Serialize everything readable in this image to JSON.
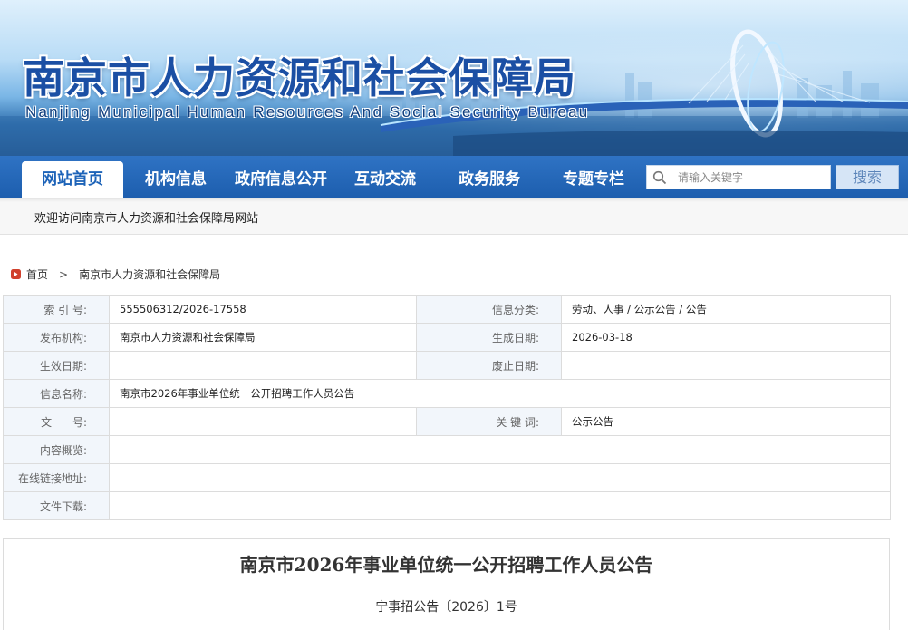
{
  "site": {
    "title_cn": "南京市人力资源和社会保障局",
    "title_en": "Nanjing Municipal Human Resources And Social Security Bureau"
  },
  "nav": {
    "items": [
      {
        "label": "网站首页",
        "active": true
      },
      {
        "label": "机构信息",
        "active": false
      },
      {
        "label": "政府信息公开",
        "active": false
      },
      {
        "label": "互动交流",
        "active": false
      },
      {
        "label": "政务服务",
        "active": false
      },
      {
        "label": "专题专栏",
        "active": false
      }
    ]
  },
  "search": {
    "placeholder": "请输入关键字",
    "button_label": "搜索",
    "icon": "search-icon"
  },
  "welcome": "欢迎访问南京市人力资源和社会保障局网站",
  "breadcrumb": {
    "home": "首页",
    "separator": ">",
    "current": "南京市人力资源和社会保障局",
    "home_icon": "home-icon",
    "home_icon_color": "#d0402c"
  },
  "info": {
    "index_label": "索 引 号:",
    "index_value": "555506312/2026-17558",
    "category_label": "信息分类:",
    "category_value": "劳动、人事 / 公示公告 / 公告",
    "publisher_label": "发布机构:",
    "publisher_value": "南京市人力资源和社会保障局",
    "created_label": "生成日期:",
    "created_value": "2026-03-18",
    "effective_label": "生效日期:",
    "effective_value": "",
    "expire_label": "废止日期:",
    "expire_value": "",
    "name_label": "信息名称:",
    "name_value": "南京市2026年事业单位统一公开招聘工作人员公告",
    "docno_label": "文      号:",
    "docno_value": "",
    "keywords_label": "关 键 词:",
    "keywords_value": "公示公告",
    "summary_label": "内容概览:",
    "summary_value": "",
    "link_label": "在线链接地址:",
    "link_value": "",
    "download_label": "文件下载:",
    "download_value": ""
  },
  "article": {
    "title": "南京市2026年事业单位统一公开招聘工作人员公告",
    "doc_number": "宁事招公告〔2026〕1号"
  },
  "colors": {
    "nav_blue": "#1d5eae",
    "title_blue": "#1b4fa4",
    "label_bg": "#f2f6fb"
  }
}
